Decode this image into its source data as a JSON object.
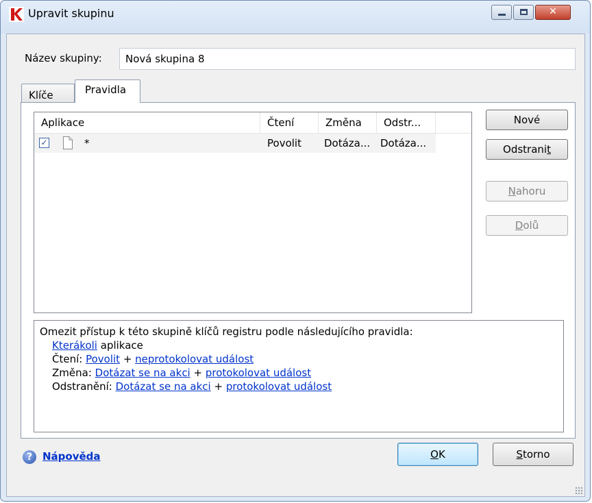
{
  "window": {
    "title": "Upravit skupinu",
    "close_glyph": "✕"
  },
  "group_name": {
    "label": "Název skupiny:",
    "value": "Nová skupina 8"
  },
  "tabs": [
    {
      "label": "Klíče",
      "active": false
    },
    {
      "label": "Pravidla",
      "active": true
    }
  ],
  "rules_table": {
    "columns": [
      "Aplikace",
      "Čtení",
      "Změna",
      "Odstr..."
    ],
    "rows": [
      {
        "checked": true,
        "check_glyph": "✓",
        "application": "*",
        "read": "Povolit",
        "change": "Dotáza...",
        "delete": "Dotáza..."
      }
    ]
  },
  "side_buttons": {
    "new": "Nové",
    "remove_pre": "Odstrani",
    "remove_key": "t",
    "up_key": "N",
    "up_rest": "ahoru",
    "down_key": "D",
    "down_rest": "olů"
  },
  "description": {
    "intro": "Omezit přístup k této skupině klíčů registru podle následujícího pravidla:",
    "app_link": "Kterákoli",
    "app_text": " aplikace",
    "read_label": "Čtení: ",
    "read_action": "Povolit",
    "read_log": "neprotokolovat událost",
    "change_label": "Změna: ",
    "change_action": "Dotázat se na akci",
    "change_log": "protokolovat událost",
    "delete_label": "Odstranění: ",
    "delete_action": "Dotázat se na akci",
    "delete_log": "protokolovat událost",
    "plus": " + "
  },
  "footer": {
    "help_glyph": "?",
    "help_label": "Nápověda",
    "ok_key": "O",
    "ok_rest": "K",
    "cancel_key": "S",
    "cancel_rest": "torno"
  },
  "colors": {
    "link": "#0033cc",
    "brand_red": "#d01818"
  }
}
